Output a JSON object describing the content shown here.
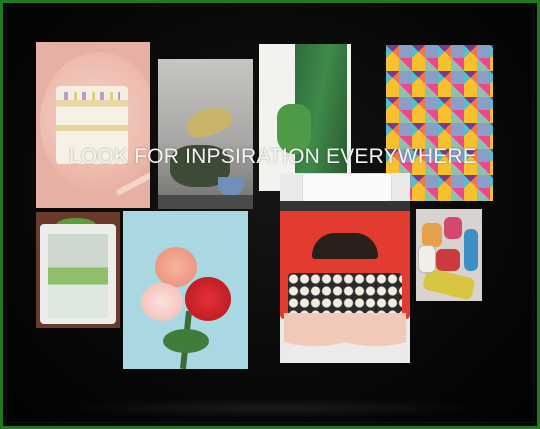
{
  "headline": "LOOK FOR INPSIRATION EVERYWHERE",
  "frame_border_color": "#1f7a1f",
  "photos": [
    {
      "subject": "cake-slice-on-pink-plate"
    },
    {
      "subject": "potted-plants-still-life"
    },
    {
      "subject": "green-dress-and-bag"
    },
    {
      "subject": "colorful-geometric-pattern"
    },
    {
      "subject": "white-cabinet-with-plants"
    },
    {
      "subject": "peony-flower-bouquet"
    },
    {
      "subject": "red-typewriter-with-hands"
    },
    {
      "subject": "colorful-thread-spools"
    }
  ]
}
